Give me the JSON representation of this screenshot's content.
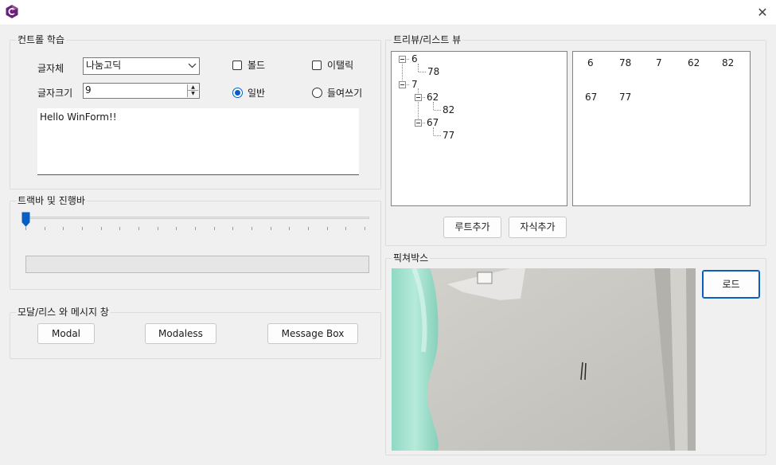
{
  "window": {
    "app_icon": "csharp-logo-icon",
    "close_icon": "close-icon",
    "close_glyph": "✕"
  },
  "control_group": {
    "title": "컨트롤 학습",
    "font_label": "글자체",
    "font_value": "나눔고딕",
    "size_label": "글자크기",
    "size_value": "9",
    "bold_label": "볼드",
    "italic_label": "이탤릭",
    "normal_label": "일반",
    "indent_label": "들여쓰기",
    "bold_checked": false,
    "italic_checked": false,
    "selected_radio": "일반",
    "text_value": "Hello WinForm!!"
  },
  "track_group": {
    "title": "트랙바 및 진행바",
    "trackbar_value": 0,
    "progress_fraction": 0
  },
  "modal_group": {
    "title": "모달/리스 와 메시지 창",
    "modal_button": "Modal",
    "modaless_button": "Modaless",
    "messagebox_button": "Message Box"
  },
  "tree_group": {
    "title": "트리뷰/리스트 뷰",
    "tree": {
      "root1": "6",
      "root1_child": "78",
      "root2": "7",
      "root2_child1": "62",
      "root2_child1_child": "82",
      "root2_child2": "67",
      "root2_child2_child": "77"
    },
    "list": {
      "item1": "6",
      "item2": "78",
      "item3": "7",
      "item4": "62",
      "item5": "82",
      "item6": "67",
      "item7": "77"
    },
    "add_root_button": "루트추가",
    "add_child_button": "자식추가"
  },
  "picture_group": {
    "title": "픽쳐박스",
    "load_button": "로드"
  },
  "colors": {
    "accent": "#0a5ec2",
    "window_bg": "#f0f0f0",
    "panel_border": "#828282"
  }
}
